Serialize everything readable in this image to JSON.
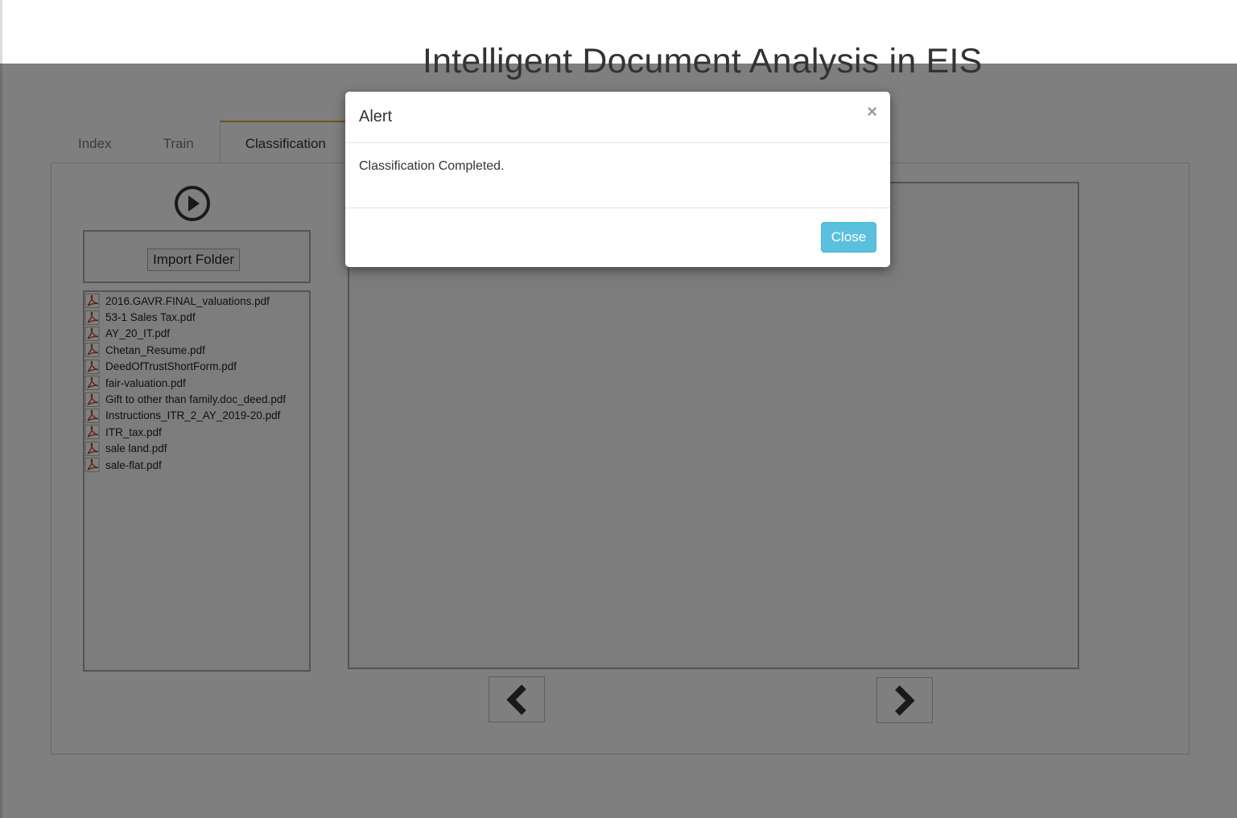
{
  "app": {
    "title": "Intelligent Document Analysis in EIS"
  },
  "tabs": [
    {
      "label": "Index",
      "active": false
    },
    {
      "label": "Train",
      "active": false
    },
    {
      "label": "Classification",
      "active": true
    }
  ],
  "controls": {
    "run_icon": "play-circle-icon",
    "import_label": "Import Folder",
    "prev_icon": "chevron-left-icon",
    "next_icon": "chevron-right-icon"
  },
  "files": [
    "2016.GAVR.FINAL_valuations.pdf",
    "53-1 Sales Tax.pdf",
    "AY_20_IT.pdf",
    "Chetan_Resume.pdf",
    "DeedOfTrustShortForm.pdf",
    "fair-valuation.pdf",
    "Gift to other than family.doc_deed.pdf",
    "Instructions_ITR_2_AY_2019-20.pdf",
    "ITR_tax.pdf",
    "sale land.pdf",
    "sale-flat.pdf"
  ],
  "modal": {
    "title": "Alert",
    "close_symbol": "×",
    "message": "Classification Completed.",
    "close_label": "Close"
  },
  "colors": {
    "active_tab_accent": "#e2a233",
    "close_button": "#5bc0de",
    "pdf_icon": "#c0392b"
  }
}
